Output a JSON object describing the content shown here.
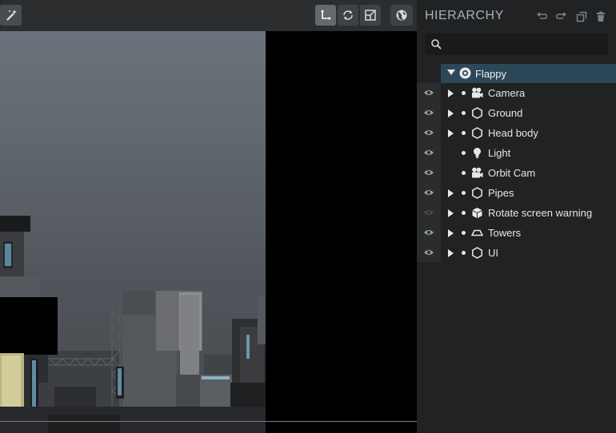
{
  "panel": {
    "title": "HIERARCHY",
    "search": {
      "value": "",
      "placeholder": ""
    }
  },
  "colors": {
    "selected_row": "#2c4757",
    "panel_bg": "#202223",
    "toolbar_bg": "#2b2d2f",
    "active_tool": "#65696d"
  },
  "toolbar": {
    "icons": [
      "magic-wand-icon",
      "translate-gizmo-icon",
      "rotate-gizmo-icon",
      "scale-gizmo-icon",
      "world-space-icon"
    ],
    "active": "translate-gizmo-icon"
  },
  "header_icons": [
    "undo-icon",
    "redo-icon",
    "duplicate-icon",
    "delete-icon"
  ],
  "hierarchy": {
    "root": {
      "label": "Flappy",
      "icon": "scene-root-icon",
      "expanded": true,
      "selected": true
    },
    "items": [
      {
        "label": "Camera",
        "icon": "camera-icon",
        "expandable": true,
        "visible": true
      },
      {
        "label": "Ground",
        "icon": "entity-hexagon-icon",
        "expandable": true,
        "visible": true
      },
      {
        "label": "Head body",
        "icon": "entity-hexagon-icon",
        "expandable": true,
        "visible": true
      },
      {
        "label": "Light",
        "icon": "lightbulb-icon",
        "expandable": false,
        "visible": true
      },
      {
        "label": "Orbit Cam",
        "icon": "camera-icon",
        "expandable": false,
        "visible": true
      },
      {
        "label": "Pipes",
        "icon": "entity-hexagon-icon",
        "expandable": true,
        "visible": true
      },
      {
        "label": "Rotate screen warning",
        "icon": "cube-icon",
        "expandable": true,
        "visible": false
      },
      {
        "label": "Towers",
        "icon": "plane-icon",
        "expandable": true,
        "visible": true
      },
      {
        "label": "UI",
        "icon": "entity-hexagon-icon",
        "expandable": true,
        "visible": true
      }
    ]
  }
}
